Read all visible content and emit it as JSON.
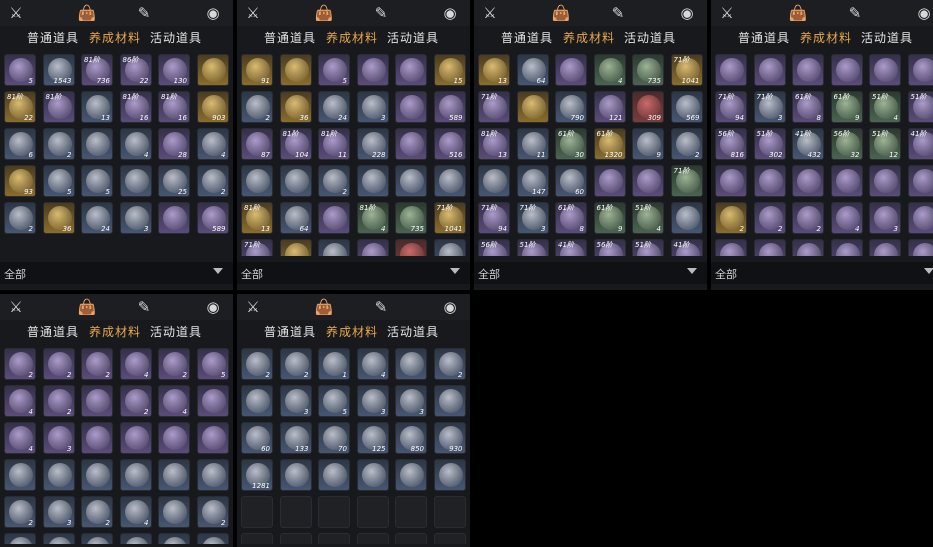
{
  "top_icons": {
    "swords": "swords-icon",
    "bag": "bag-icon",
    "torch": "torch-icon",
    "bulb": "bulb-icon"
  },
  "tabs": [
    "普通道具",
    "养成材料",
    "活动道具"
  ],
  "active_tab_index": 1,
  "filter": {
    "label": "全部"
  },
  "panels": [
    {
      "id": "p1",
      "cells": [
        [
          "",
          "5",
          0,
          "purple"
        ],
        [
          "",
          "1543",
          0,
          "blue"
        ],
        [
          "81阶",
          "736",
          0,
          "purple"
        ],
        [
          "86阶",
          "22",
          0,
          "purple"
        ],
        [
          "",
          "130",
          0,
          "purple"
        ],
        [
          "",
          "",
          0,
          "gold"
        ],
        [
          "81阶",
          "22",
          0,
          "gold"
        ],
        [
          "81阶",
          "",
          0,
          "purple"
        ],
        [
          "",
          "13",
          0,
          "blue"
        ],
        [
          "81阶",
          "16",
          0,
          "purple"
        ],
        [
          "81阶",
          "16",
          0,
          "purple"
        ],
        [
          "",
          "903",
          0,
          "gold"
        ],
        [
          "",
          "6",
          0,
          "blue"
        ],
        [
          "",
          "2",
          0,
          "blue"
        ],
        [
          "",
          "",
          0,
          "blue"
        ],
        [
          "",
          "4",
          0,
          "blue"
        ],
        [
          "",
          "28",
          0,
          "purple"
        ],
        [
          "",
          "4",
          0,
          "blue"
        ],
        [
          "",
          "93",
          0,
          "gold"
        ],
        [
          "",
          "5",
          0,
          "blue"
        ],
        [
          "",
          "5",
          0,
          "blue"
        ],
        [
          "",
          "",
          0,
          "blue"
        ],
        [
          "",
          "25",
          0,
          "blue"
        ],
        [
          "",
          "2",
          0,
          "blue"
        ],
        [
          "",
          "2",
          0,
          "blue"
        ],
        [
          "",
          "36",
          0,
          "gold"
        ],
        [
          "",
          "24",
          0,
          "blue"
        ],
        [
          "",
          "3",
          0,
          "blue"
        ],
        [
          "",
          "",
          0,
          "purple"
        ],
        [
          "",
          "589",
          0,
          "purple"
        ]
      ]
    },
    {
      "id": "p2",
      "cells": [
        [
          "",
          "91",
          0,
          "gold"
        ],
        [
          "",
          "",
          0,
          "gold"
        ],
        [
          "",
          "5",
          0,
          "purple"
        ],
        [
          "",
          "",
          0,
          "purple"
        ],
        [
          "",
          "",
          0,
          "purple"
        ],
        [
          "",
          "15",
          0,
          "gold"
        ],
        [
          "",
          "2",
          0,
          "blue"
        ],
        [
          "",
          "36",
          0,
          "gold"
        ],
        [
          "",
          "24",
          0,
          "blue"
        ],
        [
          "",
          "3",
          0,
          "blue"
        ],
        [
          "",
          "",
          0,
          "purple"
        ],
        [
          "",
          "589",
          0,
          "purple"
        ],
        [
          "",
          "87",
          0,
          "purple"
        ],
        [
          "81阶",
          "104",
          0,
          "purple"
        ],
        [
          "81阶",
          "11",
          0,
          "purple"
        ],
        [
          "",
          "228",
          0,
          "blue"
        ],
        [
          "",
          "",
          0,
          "purple"
        ],
        [
          "",
          "516",
          0,
          "purple"
        ],
        [
          "",
          "",
          0,
          "blue"
        ],
        [
          "",
          "",
          0,
          "blue"
        ],
        [
          "",
          "2",
          0,
          "blue"
        ],
        [
          "",
          "",
          0,
          "blue"
        ],
        [
          "",
          "",
          0,
          "blue"
        ],
        [
          "",
          "",
          0,
          "blue"
        ],
        [
          "81阶",
          "13",
          0,
          "gold"
        ],
        [
          "",
          "64",
          0,
          "blue"
        ],
        [
          "",
          "",
          0,
          "purple"
        ],
        [
          "81阶",
          "4",
          0,
          "green"
        ],
        [
          "",
          "735",
          0,
          "green"
        ],
        [
          "71阶",
          "1041",
          0,
          "gold"
        ],
        [
          "71阶",
          "",
          0,
          "purple"
        ],
        [
          "",
          "",
          0,
          "gold"
        ],
        [
          "",
          "",
          0,
          "blue"
        ],
        [
          "",
          "",
          0,
          "purple"
        ],
        [
          "",
          "",
          0,
          "red"
        ],
        [
          "",
          "",
          0,
          "blue"
        ]
      ]
    },
    {
      "id": "p3",
      "cells": [
        [
          "",
          "13",
          0,
          "gold"
        ],
        [
          "",
          "64",
          0,
          "blue"
        ],
        [
          "",
          "",
          0,
          "purple"
        ],
        [
          "",
          "4",
          0,
          "green"
        ],
        [
          "",
          "735",
          0,
          "green"
        ],
        [
          "71阶",
          "1041",
          0,
          "gold"
        ],
        [
          "71阶",
          "",
          0,
          "purple"
        ],
        [
          "",
          "",
          0,
          "gold"
        ],
        [
          "",
          "790",
          0,
          "blue"
        ],
        [
          "",
          "121",
          0,
          "purple"
        ],
        [
          "",
          "309",
          0,
          "red"
        ],
        [
          "",
          "569",
          0,
          "blue"
        ],
        [
          "81阶",
          "13",
          0,
          "purple"
        ],
        [
          "",
          "11",
          0,
          "blue"
        ],
        [
          "61阶",
          "30",
          0,
          "green"
        ],
        [
          "61阶",
          "1320",
          0,
          "gold"
        ],
        [
          "",
          "9",
          0,
          "blue"
        ],
        [
          "",
          "2",
          0,
          "blue"
        ],
        [
          "",
          "",
          0,
          "blue"
        ],
        [
          "",
          "147",
          0,
          "blue"
        ],
        [
          "",
          "60",
          0,
          "blue"
        ],
        [
          "",
          "",
          0,
          "purple"
        ],
        [
          "",
          "",
          0,
          "purple"
        ],
        [
          "71阶",
          "",
          0,
          "green"
        ],
        [
          "71阶",
          "94",
          0,
          "purple"
        ],
        [
          "71阶",
          "3",
          0,
          "blue"
        ],
        [
          "61阶",
          "8",
          0,
          "purple"
        ],
        [
          "61阶",
          "9",
          0,
          "green"
        ],
        [
          "51阶",
          "4",
          0,
          "green"
        ],
        [
          "",
          "",
          0,
          "blue"
        ],
        [
          "56阶",
          "",
          0,
          "purple"
        ],
        [
          "51阶",
          "",
          0,
          "purple"
        ],
        [
          "41阶",
          "",
          0,
          "purple"
        ],
        [
          "56阶",
          "",
          0,
          "purple"
        ],
        [
          "51阶",
          "",
          0,
          "purple"
        ],
        [
          "41阶",
          "",
          0,
          "purple"
        ]
      ]
    },
    {
      "id": "p4",
      "cells": [
        [
          "",
          "",
          0,
          "purple"
        ],
        [
          "",
          "",
          0,
          "purple"
        ],
        [
          "",
          "",
          0,
          "purple"
        ],
        [
          "",
          "",
          0,
          "purple"
        ],
        [
          "",
          "",
          0,
          "purple"
        ],
        [
          "",
          "",
          0,
          "purple"
        ],
        [
          "71阶",
          "94",
          0,
          "purple"
        ],
        [
          "71阶",
          "3",
          0,
          "blue"
        ],
        [
          "61阶",
          "8",
          0,
          "purple"
        ],
        [
          "61阶",
          "9",
          0,
          "green"
        ],
        [
          "51阶",
          "4",
          0,
          "green"
        ],
        [
          "51阶",
          "",
          0,
          "purple"
        ],
        [
          "56阶",
          "816",
          0,
          "purple"
        ],
        [
          "51阶",
          "302",
          0,
          "purple"
        ],
        [
          "41阶",
          "432",
          0,
          "blue"
        ],
        [
          "56阶",
          "32",
          0,
          "green"
        ],
        [
          "51阶",
          "12",
          0,
          "green"
        ],
        [
          "41阶",
          "",
          0,
          "purple"
        ],
        [
          "",
          "",
          0,
          "purple"
        ],
        [
          "",
          "",
          0,
          "purple"
        ],
        [
          "",
          "",
          0,
          "purple"
        ],
        [
          "",
          "",
          0,
          "purple"
        ],
        [
          "",
          "",
          0,
          "purple"
        ],
        [
          "",
          "",
          0,
          "purple"
        ],
        [
          "",
          "2",
          0,
          "gold"
        ],
        [
          "",
          "2",
          0,
          "purple"
        ],
        [
          "",
          "2",
          0,
          "purple"
        ],
        [
          "",
          "4",
          0,
          "purple"
        ],
        [
          "",
          "3",
          0,
          "purple"
        ],
        [
          "",
          "",
          0,
          "purple"
        ],
        [
          "",
          "4",
          0,
          "purple"
        ],
        [
          "",
          "2",
          0,
          "purple"
        ],
        [
          "",
          "3",
          0,
          "purple"
        ],
        [
          "",
          "5",
          0,
          "purple"
        ],
        [
          "",
          "3",
          0,
          "purple"
        ],
        [
          "",
          "",
          0,
          "purple"
        ]
      ]
    },
    {
      "id": "p5",
      "cells": [
        [
          "",
          "2",
          0,
          "purple"
        ],
        [
          "",
          "2",
          0,
          "purple"
        ],
        [
          "",
          "2",
          0,
          "purple"
        ],
        [
          "",
          "4",
          0,
          "purple"
        ],
        [
          "",
          "2",
          0,
          "purple"
        ],
        [
          "",
          "5",
          0,
          "purple"
        ],
        [
          "",
          "4",
          0,
          "purple"
        ],
        [
          "",
          "2",
          0,
          "purple"
        ],
        [
          "",
          "",
          0,
          "purple"
        ],
        [
          "",
          "2",
          0,
          "purple"
        ],
        [
          "",
          "4",
          0,
          "purple"
        ],
        [
          "",
          "",
          0,
          "purple"
        ],
        [
          "",
          "4",
          0,
          "purple"
        ],
        [
          "",
          "3",
          0,
          "purple"
        ],
        [
          "",
          "",
          0,
          "purple"
        ],
        [
          "",
          "",
          0,
          "purple"
        ],
        [
          "",
          "",
          0,
          "purple"
        ],
        [
          "",
          "",
          0,
          "purple"
        ],
        [
          "",
          "",
          0,
          "blue"
        ],
        [
          "",
          "",
          0,
          "blue"
        ],
        [
          "",
          "",
          0,
          "blue"
        ],
        [
          "",
          "",
          0,
          "blue"
        ],
        [
          "",
          "",
          0,
          "blue"
        ],
        [
          "",
          "",
          0,
          "blue"
        ],
        [
          "",
          "2",
          0,
          "blue"
        ],
        [
          "",
          "3",
          0,
          "blue"
        ],
        [
          "",
          "2",
          0,
          "blue"
        ],
        [
          "",
          "4",
          0,
          "blue"
        ],
        [
          "",
          "",
          0,
          "blue"
        ],
        [
          "",
          "2",
          0,
          "blue"
        ],
        [
          "",
          "",
          0,
          "blue"
        ],
        [
          "",
          "",
          0,
          "blue"
        ],
        [
          "",
          "",
          0,
          "blue"
        ],
        [
          "",
          "",
          0,
          "blue"
        ],
        [
          "",
          "",
          0,
          "blue"
        ],
        [
          "",
          "",
          0,
          "blue"
        ]
      ]
    },
    {
      "id": "p6",
      "cells": [
        [
          "",
          "2",
          0,
          "blue"
        ],
        [
          "",
          "2",
          0,
          "blue"
        ],
        [
          "",
          "1",
          0,
          "blue"
        ],
        [
          "",
          "4",
          0,
          "blue"
        ],
        [
          "",
          "",
          0,
          "blue"
        ],
        [
          "",
          "2",
          0,
          "blue"
        ],
        [
          "",
          "",
          0,
          "blue"
        ],
        [
          "",
          "3",
          0,
          "blue"
        ],
        [
          "",
          "5",
          0,
          "blue"
        ],
        [
          "",
          "3",
          0,
          "blue"
        ],
        [
          "",
          "3",
          0,
          "blue"
        ],
        [
          "",
          "",
          0,
          "blue"
        ],
        [
          "",
          "60",
          0,
          "blue"
        ],
        [
          "",
          "133",
          0,
          "blue"
        ],
        [
          "",
          "70",
          0,
          "blue"
        ],
        [
          "",
          "125",
          0,
          "blue"
        ],
        [
          "",
          "850",
          0,
          "blue"
        ],
        [
          "",
          "930",
          0,
          "blue"
        ],
        [
          "",
          "1281",
          0,
          "blue"
        ],
        [
          "",
          "",
          0,
          "blue"
        ],
        [
          "",
          "",
          0,
          "blue"
        ],
        [
          "",
          "",
          0,
          "blue"
        ],
        [
          "",
          "",
          0,
          "blue"
        ],
        [
          "",
          "",
          0,
          "blue"
        ],
        [
          "",
          "",
          0,
          "empty"
        ],
        [
          "",
          "",
          0,
          "empty"
        ],
        [
          "",
          "",
          0,
          "empty"
        ],
        [
          "",
          "",
          0,
          "empty"
        ],
        [
          "",
          "",
          0,
          "empty"
        ],
        [
          "",
          "",
          0,
          "empty"
        ],
        [
          "",
          "",
          0,
          "empty"
        ],
        [
          "",
          "",
          0,
          "empty"
        ],
        [
          "",
          "",
          0,
          "empty"
        ],
        [
          "",
          "",
          0,
          "empty"
        ],
        [
          "",
          "",
          0,
          "empty"
        ],
        [
          "",
          "",
          0,
          "empty"
        ]
      ]
    }
  ]
}
